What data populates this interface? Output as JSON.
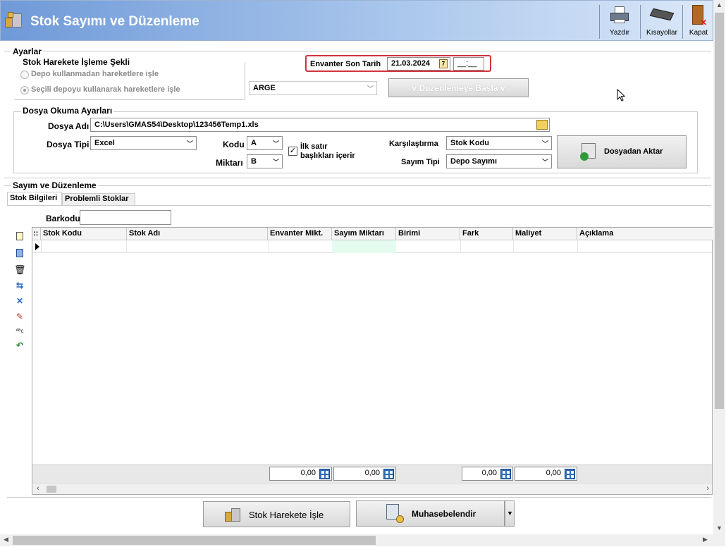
{
  "window": {
    "title": "Stok Sayımı ve Düzenleme"
  },
  "toolbar": {
    "print_label": "Yazdır",
    "shortcuts_label": "Kısayollar",
    "close_label": "Kapat"
  },
  "settings": {
    "group_title": "Ayarlar",
    "movement_mode": {
      "title": "Stok Harekete İşleme Şekli",
      "option_no_depot": "Depo kullanmadan hareketlere işle",
      "option_selected_depot": "Seçili depoyu kullanarak hareketlere işle"
    },
    "inventory_date_label": "Envanter Son Tarih",
    "inventory_date_value": "21.03.2024",
    "inventory_time_value": "__:__",
    "depot_value": "ARGE",
    "start_button": "v Düzenlemeye Başla v"
  },
  "file_settings": {
    "group_title": "Dosya Okuma Ayarları",
    "file_name_label": "Dosya Adı",
    "file_name_value": "C:\\Users\\GMAS54\\Desktop\\123456Temp1.xls",
    "file_type_label": "Dosya Tipi",
    "file_type_value": "Excel",
    "code_label": "Kodu",
    "code_value": "A",
    "quantity_label": "Miktarı",
    "quantity_value": "B",
    "first_row_header_label_1": "İlk satır",
    "first_row_header_label_2": "başlıkları içerir",
    "compare_label": "Karşılaştırma",
    "compare_value": "Stok Kodu",
    "count_type_label": "Sayım Tipi",
    "count_type_value": "Depo Sayımı",
    "import_button": "Dosyadan Aktar"
  },
  "count": {
    "group_title": "Sayım ve Düzenleme",
    "tabs": [
      "Stok Bilgileri",
      "Problemli Stoklar"
    ],
    "barcode_label": "Barkodu",
    "columns": [
      "Stok Kodu",
      "Stok Adı",
      "Envanter Mikt.",
      "Sayım Miktarı",
      "Birimi",
      "Fark",
      "Maliyet",
      "Açıklama"
    ],
    "totals": [
      "0,00",
      "0,00",
      "0,00",
      "0,00"
    ]
  },
  "footer": {
    "process_button": "Stok Harekete İşle",
    "accounting_button": "Muhasebelendir"
  }
}
